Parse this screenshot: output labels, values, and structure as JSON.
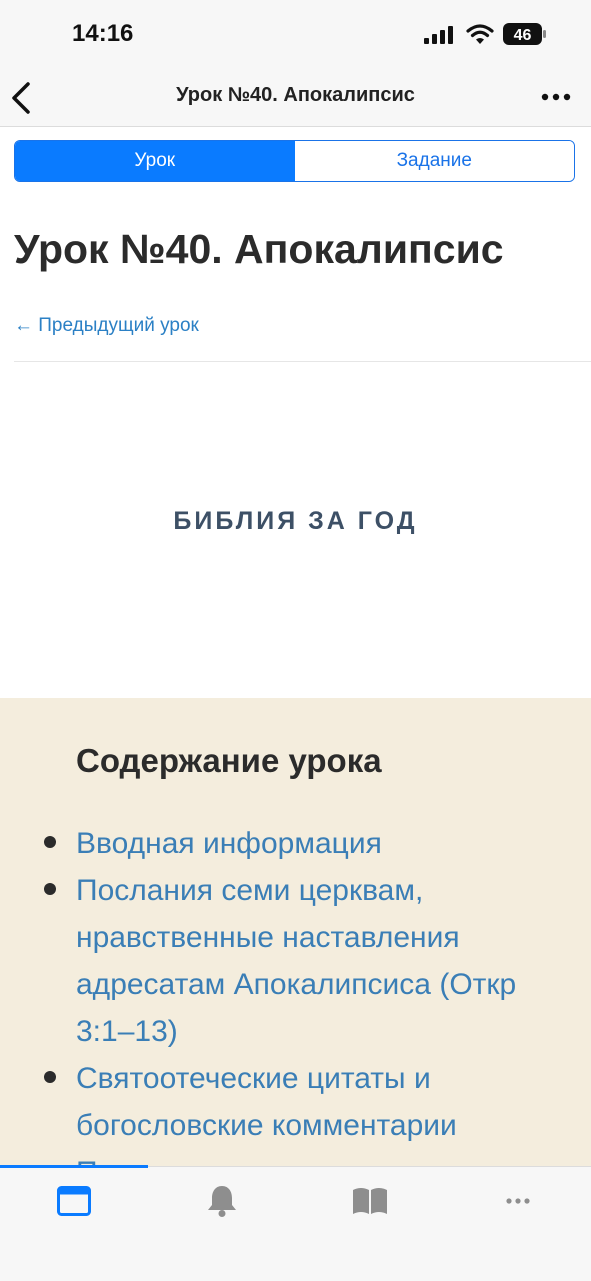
{
  "status": {
    "time": "14:16",
    "battery": "46"
  },
  "nav": {
    "title": "Урок №40. Апокалипсис"
  },
  "segments": [
    {
      "label": "Урок",
      "active": true
    },
    {
      "label": "Задание",
      "active": false
    }
  ],
  "page": {
    "title": "Урок №40. Апокалипсис",
    "prev_link": "← Предыдущий урок",
    "banner": "БИБЛИЯ ЗА ГОД"
  },
  "contents": {
    "heading": "Содержание урока",
    "items": [
      "Вводная информация",
      "Послания семи церквам, нравственные наставления адресатам Апокалипсиса (Откр 3:1–13)",
      "Святоотеческие цитаты и богословские комментарии",
      "Полезно узнать"
    ]
  },
  "tabbar": {
    "icons": [
      "lesson-icon",
      "bell-icon",
      "book-icon",
      "more-icon"
    ],
    "active_color": "#0a7bff",
    "inactive_color": "#8e8e8e"
  }
}
